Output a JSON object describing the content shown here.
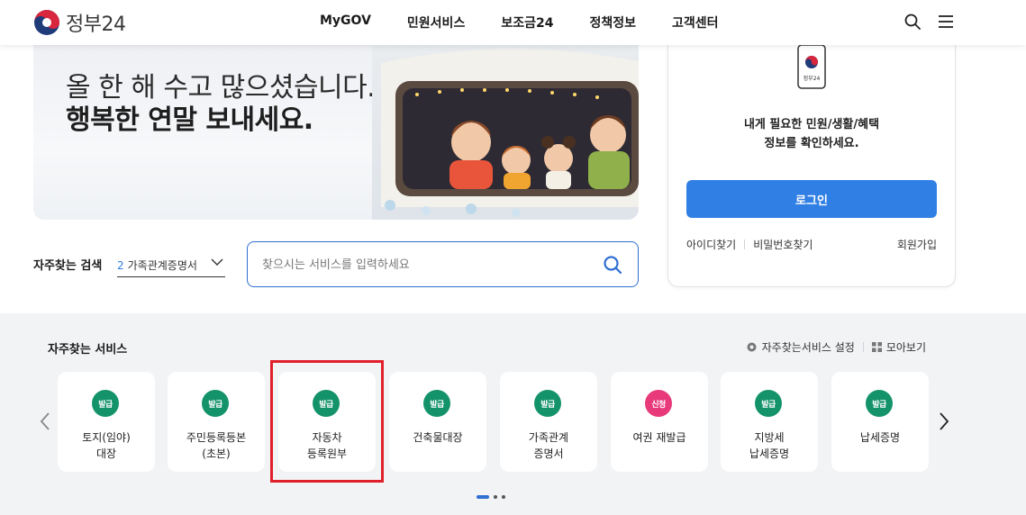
{
  "header": {
    "logo_text": "정부24",
    "nav": [
      "MyGOV",
      "민원서비스",
      "보조금24",
      "정책정보",
      "고객센터"
    ],
    "search_icon": "search-icon",
    "menu_icon": "hamburger-menu-icon"
  },
  "banner": {
    "line1": "올 한 해 수고 많으셨습니다.",
    "line2": "행복한 연말 보내세요."
  },
  "login": {
    "phone_label": "정부24",
    "message_line1": "내게 필요한 민원/생활/혜택",
    "message_line2": "정보를 확인하세요.",
    "button": "로그인",
    "find_id": "아이디찾기",
    "find_pw": "비밀번호찾기",
    "signup": "회원가입"
  },
  "search": {
    "fav_label": "자주찾는 검색",
    "fav_num": "2",
    "fav_value": "가족관계증명서",
    "placeholder": "찾으시는 서비스를 입력하세요"
  },
  "services": {
    "title": "자주찾는 서비스",
    "settings": "자주찾는서비스 설정",
    "grid_view": "모아보기",
    "cards": [
      {
        "badge": "발급",
        "label": "토지(임야)\n대장",
        "color": "#14936a"
      },
      {
        "badge": "발급",
        "label": "주민등록등본\n(초본)",
        "color": "#14936a"
      },
      {
        "badge": "발급",
        "label": "자동차\n등록원부",
        "color": "#14936a"
      },
      {
        "badge": "발급",
        "label": "건축물대장",
        "color": "#14936a"
      },
      {
        "badge": "발급",
        "label": "가족관계\n증명서",
        "color": "#14936a"
      },
      {
        "badge": "신청",
        "label": "여권 재발급",
        "color": "#e8397a"
      },
      {
        "badge": "발급",
        "label": "지방세\n납세증명",
        "color": "#14936a"
      },
      {
        "badge": "발급",
        "label": "납세증명",
        "color": "#14936a"
      }
    ],
    "pagination": {
      "current": 1,
      "total": 3
    }
  },
  "colors": {
    "primary": "#2f7fe4",
    "search_border": "#2f6fd2",
    "issue_badge": "#14936a",
    "apply_badge": "#e8397a",
    "highlight": "#e0202a"
  }
}
